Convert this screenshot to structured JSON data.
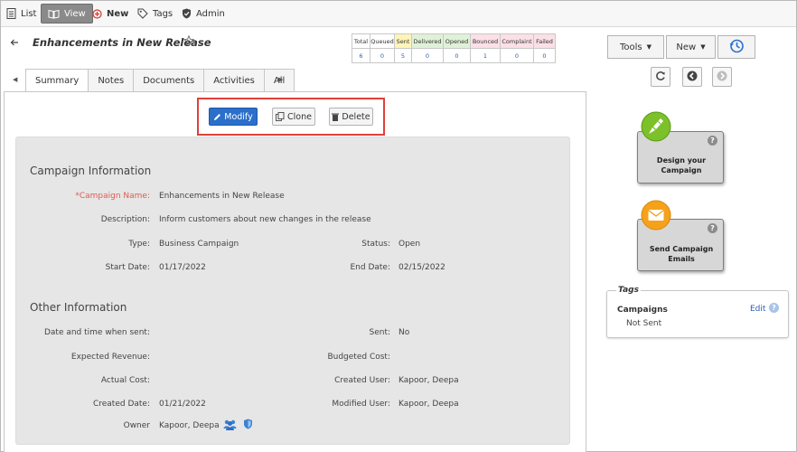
{
  "toolbar": {
    "list_label": "List",
    "view_label": "View",
    "new_label": "New",
    "tags_label": "Tags",
    "admin_label": "Admin"
  },
  "record": {
    "title": "Enhancements in New Release"
  },
  "stats": {
    "headers": [
      "Total",
      "Queued",
      "Sent",
      "Delivered",
      "Opened",
      "Bounced",
      "Complaint",
      "Failed"
    ],
    "values": [
      "6",
      "0",
      "5",
      "0",
      "0",
      "1",
      "0",
      "0"
    ],
    "header_colors": [
      "#ffffff",
      "#ffffff",
      "#fff5b8",
      "#dff2d8",
      "#dff2d8",
      "#fbe0e8",
      "#fbe0e8",
      "#fbe0e8"
    ]
  },
  "tabs": [
    "Summary",
    "Notes",
    "Documents",
    "Activities",
    "All"
  ],
  "actions": {
    "modify_label": "Modify",
    "clone_label": "Clone",
    "delete_label": "Delete"
  },
  "campaign_info": {
    "section_title": "Campaign Information",
    "name_label": "*Campaign Name:",
    "name_value": "Enhancements in New Release",
    "description_label": "Description:",
    "description_value": "Inform customers about new changes in the release",
    "type_label": "Type:",
    "type_value": "Business Campaign",
    "status_label": "Status:",
    "status_value": "Open",
    "start_date_label": "Start Date:",
    "start_date_value": "01/17/2022",
    "end_date_label": "End Date:",
    "end_date_value": "02/15/2022"
  },
  "other_info": {
    "section_title": "Other Information",
    "date_sent_label": "Date and time when sent:",
    "date_sent_value": "",
    "sent_label": "Sent:",
    "sent_value": "No",
    "expected_revenue_label": "Expected Revenue:",
    "expected_revenue_value": "",
    "budgeted_cost_label": "Budgeted Cost:",
    "budgeted_cost_value": "",
    "actual_cost_label": "Actual Cost:",
    "actual_cost_value": "",
    "created_user_label": "Created User:",
    "created_user_value": "Kapoor, Deepa",
    "created_date_label": "Created Date:",
    "created_date_value": "01/21/2022",
    "modified_user_label": "Modified User:",
    "modified_user_value": "Kapoor, Deepa",
    "owner_label": "Owner",
    "owner_value": "Kapoor, Deepa"
  },
  "right_panel": {
    "tools_label": "Tools",
    "new_label": "New",
    "design_label": "Design your Campaign",
    "send_label": "Send Campaign Emails",
    "help_glyph": "?",
    "tags_title": "Tags",
    "tags_category": "Campaigns",
    "tags_edit": "Edit",
    "tags_item": "Not Sent"
  },
  "colors": {
    "primary_button": "#2b6fcb",
    "highlight_border": "#e0403a",
    "required_label": "#e15a4f",
    "link": "#2a5db0",
    "design_badge": "#7cc02a",
    "send_badge": "#f5a21a"
  },
  "icons": {
    "list": "list-icon",
    "view": "book-icon",
    "new": "plus-circle-icon",
    "tags": "tag-icon",
    "admin": "shield-check-icon",
    "back": "arrow-left-icon",
    "favorite": "star-outline-icon",
    "history": "history-clock-icon",
    "refresh": "refresh-icon",
    "prev": "previous-record-icon",
    "next": "next-record-icon",
    "design": "brush-icon",
    "send": "envelope-icon",
    "owner_group": "users-icon",
    "owner_security": "shield-icon",
    "help": "help-icon"
  }
}
